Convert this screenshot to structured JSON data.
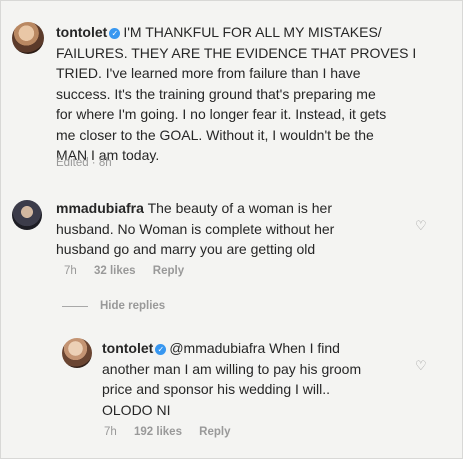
{
  "post": {
    "username": "tontolet",
    "caption_lines": [
      "I'M THANKFUL FOR ALL MY MISTAKES/",
      "FAILURES. THEY ARE THE EVIDENCE THAT PROVES I",
      "TRIED. I've learned more from failure than I have",
      "success. It's the training ground that's preparing me",
      "for where I'm going. I no longer fear it. Instead, it gets",
      "me closer to the GOAL. Without it, I wouldn't be the",
      "MAN I am today."
    ],
    "edited": "Edited · 8h"
  },
  "comment": {
    "username": "mmadubiafra",
    "text_lines": [
      "The beauty of a woman is her",
      "husband. No Woman is complete without her",
      "husband go and marry you are getting old"
    ],
    "time": "7h",
    "likes": "32 likes",
    "reply": "Reply"
  },
  "hide_replies": "Hide replies",
  "reply": {
    "username": "tontolet",
    "mention": "@mmadubiafra",
    "text_lines": [
      "When I find",
      "another man I am willing to pay his groom",
      "price and sponsor his wedding I will..",
      "OLODO NI"
    ],
    "time": "7h",
    "likes": "192 likes",
    "reply": "Reply"
  },
  "icons": {
    "verified": "verified-badge-icon",
    "like": "heart-outline-icon"
  },
  "colors": {
    "verified": "#3897f0",
    "meta": "#999999",
    "text": "#262626"
  }
}
